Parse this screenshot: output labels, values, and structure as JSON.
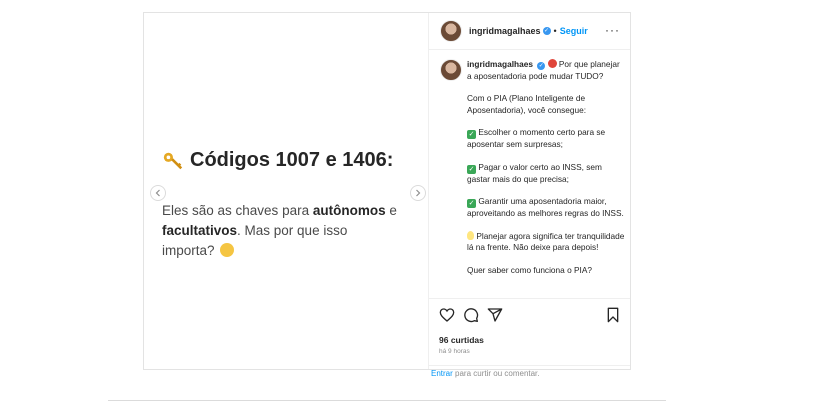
{
  "post": {
    "headline": "Códigos 1007 e 1406:",
    "body_part1": "Eles são as chaves para ",
    "body_bold1": "autônomos",
    "body_part2": " e ",
    "body_bold2": "facultativos",
    "body_part3": ". Mas por que isso importa?",
    "prev_icon": "chevron-left-icon",
    "next_icon": "chevron-right-icon"
  },
  "header": {
    "username": "ingridmagalhaes",
    "separator": "•",
    "follow_label": "Seguir",
    "more_label": "···"
  },
  "caption": {
    "username": "ingridmagalhaes",
    "intro": "Por que planejar a aposentadoria pode mudar TUDO?",
    "p2": "Com o PIA (Plano Inteligente de Aposentadoria), você consegue:",
    "p3": "Escolher o momento certo para se aposentar sem surpresas;",
    "p4": "Pagar o valor certo ao INSS, sem gastar mais do que precisa;",
    "p5": "Garantir uma aposentadoria maior, aproveitando as melhores regras do INSS.",
    "p6": "Planejar agora significa ter tranquilidade lá na frente. Não deixe para depois!",
    "p7": "Quer saber como funciona o PIA?"
  },
  "actions": {
    "likes": "96 curtidas",
    "time": "há 9 horas"
  },
  "comment": {
    "login_link": "Entrar",
    "rest": " para curtir ou comentar."
  },
  "colors": {
    "accent": "#0095f6",
    "verified": "#3897f0",
    "check": "#3aa757"
  }
}
